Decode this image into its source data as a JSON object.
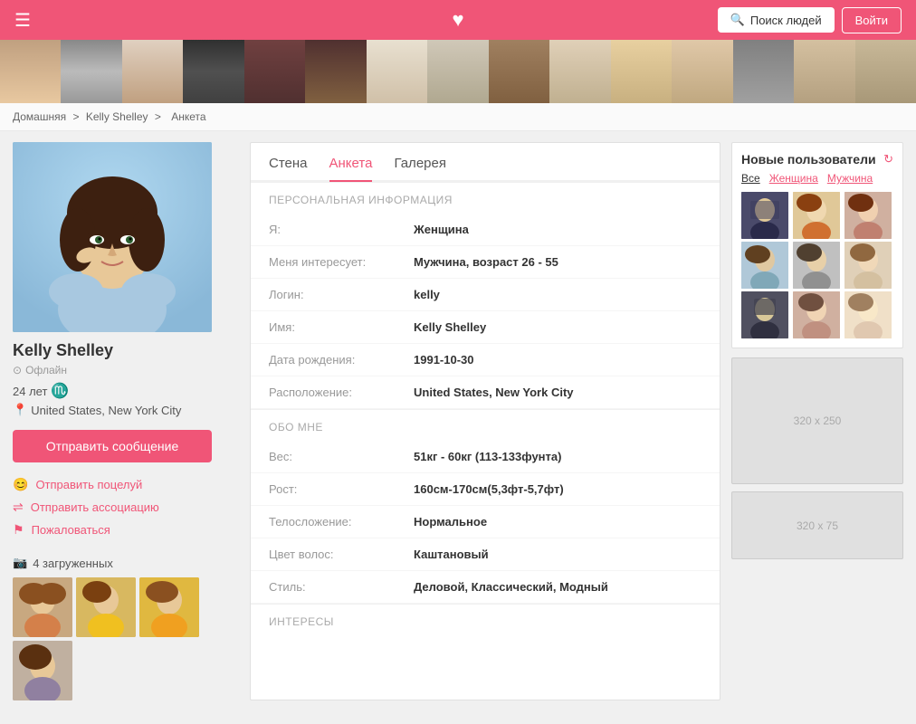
{
  "header": {
    "search_btn": "Поиск людей",
    "login_btn": "Войти",
    "heart": "♥"
  },
  "breadcrumb": {
    "home": "Домашняя",
    "sep1": ">",
    "user": "Kelly Shelley",
    "sep2": ">",
    "page": "Анкета"
  },
  "profile": {
    "name": "Kelly Shelley",
    "status": "Офлайн",
    "age": "24 лет",
    "zodiac": "♏",
    "location": "United States, New York City",
    "send_msg_btn": "Отправить сообщение",
    "actions": {
      "kiss": "Отправить поцелуй",
      "assoc": "Отправить ассоциацию",
      "report": "Пожаловаться"
    },
    "photos_label": "4 загруженных"
  },
  "tabs": {
    "wall": "Стена",
    "profile": "Анкета",
    "gallery": "Галерея"
  },
  "personal_info": {
    "section_title": "ПЕРСОНАЛЬНАЯ ИНФОРМАЦИЯ",
    "fields": [
      {
        "label": "Я:",
        "value": "Женщина"
      },
      {
        "label": "Меня интересует:",
        "value": "Мужчина, возраст 26 - 55"
      },
      {
        "label": "Логин:",
        "value": "kelly"
      },
      {
        "label": "Имя:",
        "value": "Kelly Shelley"
      },
      {
        "label": "Дата рождения:",
        "value": "1991-10-30"
      },
      {
        "label": "Расположение:",
        "value": "United States, New York City"
      }
    ]
  },
  "about_me": {
    "section_title": "ОБО МНЕ",
    "fields": [
      {
        "label": "Вес:",
        "value": "51кг - 60кг (113-133фунта)"
      },
      {
        "label": "Рост:",
        "value": "160см-170см(5,3фт-5,7фт)"
      },
      {
        "label": "Телосложение:",
        "value": "Нормальное"
      },
      {
        "label": "Цвет волос:",
        "value": "Каштановый"
      },
      {
        "label": "Стиль:",
        "value": "Деловой, Классический, Модный"
      }
    ]
  },
  "interests": {
    "section_title": "ИНТЕРЕСЫ"
  },
  "new_users": {
    "title": "Новые пользователи",
    "filter_all": "Все",
    "filter_female": "Женщина",
    "filter_male": "Мужчина"
  },
  "ads": {
    "large": "320 x 250",
    "small": "320 x 75"
  }
}
